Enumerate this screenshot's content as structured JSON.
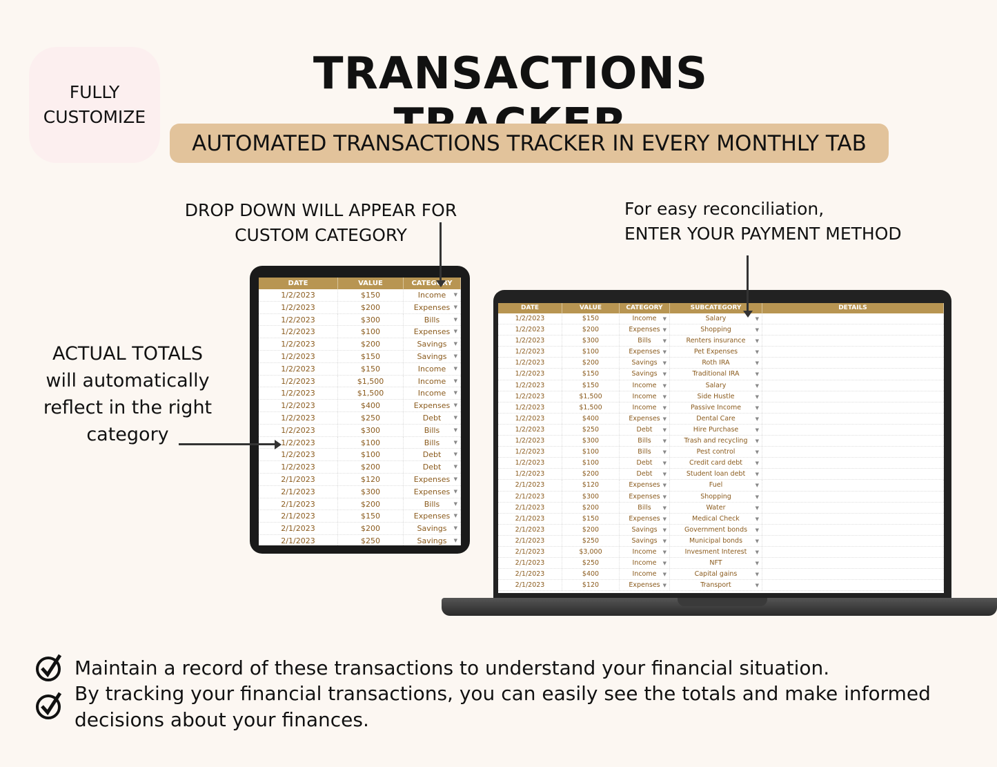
{
  "badge": "FULLY\nCUSTOMIZE",
  "title": "TRANSACTIONS TRACKER",
  "subtitle": "AUTOMATED TRANSACTIONS TRACKER IN EVERY MONTHLY TAB",
  "notes": {
    "dropdown": "DROP DOWN WILL APPEAR FOR\nCUSTOM CATEGORY",
    "payment": "For easy reconciliation,\n ENTER YOUR PAYMENT METHOD",
    "totals": "ACTUAL TOTALS\nwill automatically\nreflect in the right\ncategory"
  },
  "colors": {
    "header": "#b89552",
    "text": "#8a5a1c",
    "banner": "#e2c39b",
    "background": "#fcf7f2"
  },
  "tablet": {
    "headers": [
      "DATE",
      "VALUE",
      "CATEGORY"
    ]
  },
  "laptop": {
    "headers": [
      "DATE",
      "VALUE",
      "CATEGORY",
      "SUBCATEGORY",
      "DETAILS"
    ]
  },
  "rows": [
    [
      "1/2/2023",
      "$150",
      "Income",
      "Salary"
    ],
    [
      "1/2/2023",
      "$200",
      "Expenses",
      "Shopping"
    ],
    [
      "1/2/2023",
      "$300",
      "Bills",
      "Renters insurance"
    ],
    [
      "1/2/2023",
      "$100",
      "Expenses",
      "Pet Expenses"
    ],
    [
      "1/2/2023",
      "$200",
      "Savings",
      "Roth IRA"
    ],
    [
      "1/2/2023",
      "$150",
      "Savings",
      "Traditional IRA"
    ],
    [
      "1/2/2023",
      "$150",
      "Income",
      "Salary"
    ],
    [
      "1/2/2023",
      "$1,500",
      "Income",
      "Side Hustle"
    ],
    [
      "1/2/2023",
      "$1,500",
      "Income",
      "Passive Income"
    ],
    [
      "1/2/2023",
      "$400",
      "Expenses",
      "Dental Care"
    ],
    [
      "1/2/2023",
      "$250",
      "Debt",
      "Hire Purchase"
    ],
    [
      "1/2/2023",
      "$300",
      "Bills",
      "Trash and recycling"
    ],
    [
      "1/2/2023",
      "$100",
      "Bills",
      "Pest control"
    ],
    [
      "1/2/2023",
      "$100",
      "Debt",
      "Credit card debt"
    ],
    [
      "1/2/2023",
      "$200",
      "Debt",
      "Student loan debt"
    ],
    [
      "2/1/2023",
      "$120",
      "Expenses",
      "Fuel"
    ],
    [
      "2/1/2023",
      "$300",
      "Expenses",
      "Shopping"
    ],
    [
      "2/1/2023",
      "$200",
      "Bills",
      "Water"
    ],
    [
      "2/1/2023",
      "$150",
      "Expenses",
      "Medical  Check"
    ],
    [
      "2/1/2023",
      "$200",
      "Savings",
      "Government bonds"
    ],
    [
      "2/1/2023",
      "$250",
      "Savings",
      "Municipal bonds"
    ],
    [
      "2/1/2023",
      "$3,000",
      "Income",
      "Invesment Interest"
    ],
    [
      "2/1/2023",
      "$250",
      "Income",
      "NFT"
    ],
    [
      "2/1/2023",
      "$400",
      "Income",
      "Capital gains"
    ],
    [
      "2/1/2023",
      "$120",
      "Expenses",
      "Transport"
    ]
  ],
  "bullets": [
    "Maintain a record of these transactions to understand your financial situation.",
    "By tracking your financial transactions, you can easily see the totals and make informed\n decisions about your finances."
  ],
  "icons": {
    "check": "check-circle-icon",
    "dropdown": "caret-down-icon"
  }
}
